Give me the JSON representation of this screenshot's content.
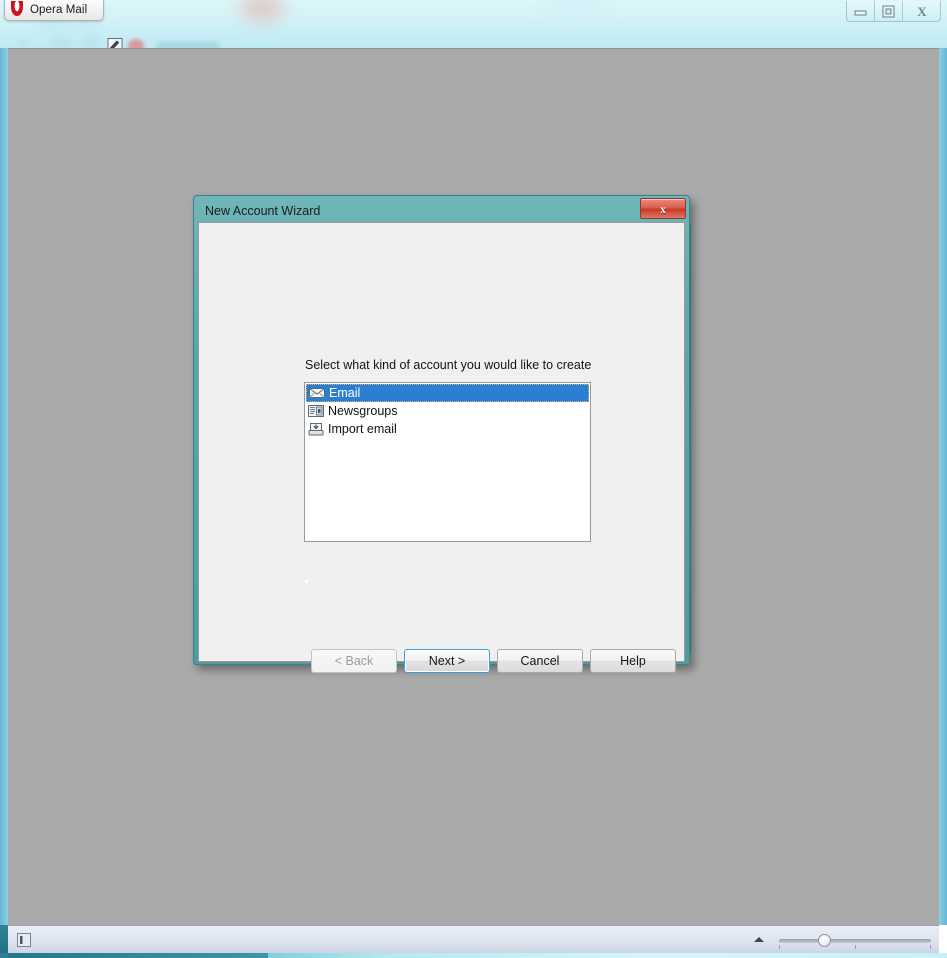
{
  "window": {
    "tab_title": "Opera Mail",
    "logo_icon": "opera-logo-icon",
    "controls": [
      {
        "name": "minimize-button",
        "icon": "minimize-icon"
      },
      {
        "name": "restore-button",
        "icon": "restore-icon"
      },
      {
        "name": "close-button",
        "icon": "close-icon"
      }
    ],
    "toolbar": {
      "compose_icon": "compose-icon",
      "unread_badge_icon": "unread-dot-icon"
    }
  },
  "dialog": {
    "title": "New Account Wizard",
    "close_label": "x",
    "prompt": "Select what kind of account you would like to create",
    "list": {
      "items": [
        {
          "label": "Email",
          "icon": "envelope-icon",
          "selected": true
        },
        {
          "label": "Newsgroups",
          "icon": "newspaper-icon",
          "selected": false
        },
        {
          "label": "Import email",
          "icon": "import-tray-icon",
          "selected": false
        }
      ]
    },
    "buttons": [
      {
        "label": "< Back",
        "state": "disabled",
        "name": "back-button"
      },
      {
        "label": "Next >",
        "state": "default",
        "name": "next-button"
      },
      {
        "label": "Cancel",
        "state": "normal",
        "name": "cancel-button"
      },
      {
        "label": "Help",
        "state": "normal",
        "name": "help-button"
      }
    ]
  },
  "statusbar": {
    "panel_toggle_icon": "panel-toggle-icon",
    "expand_arrow_icon": "chevron-up-icon",
    "zoom_slider": {
      "value": 28,
      "min": 0,
      "max": 100
    }
  },
  "colors": {
    "dialog_frame": "#4e9ba0",
    "selection": "#2a7fd4",
    "close_red": "#c53a27",
    "canvas": "#aaaaaa",
    "accent_cyan": "#8ccfe0",
    "opera_red": "#cc1122"
  }
}
